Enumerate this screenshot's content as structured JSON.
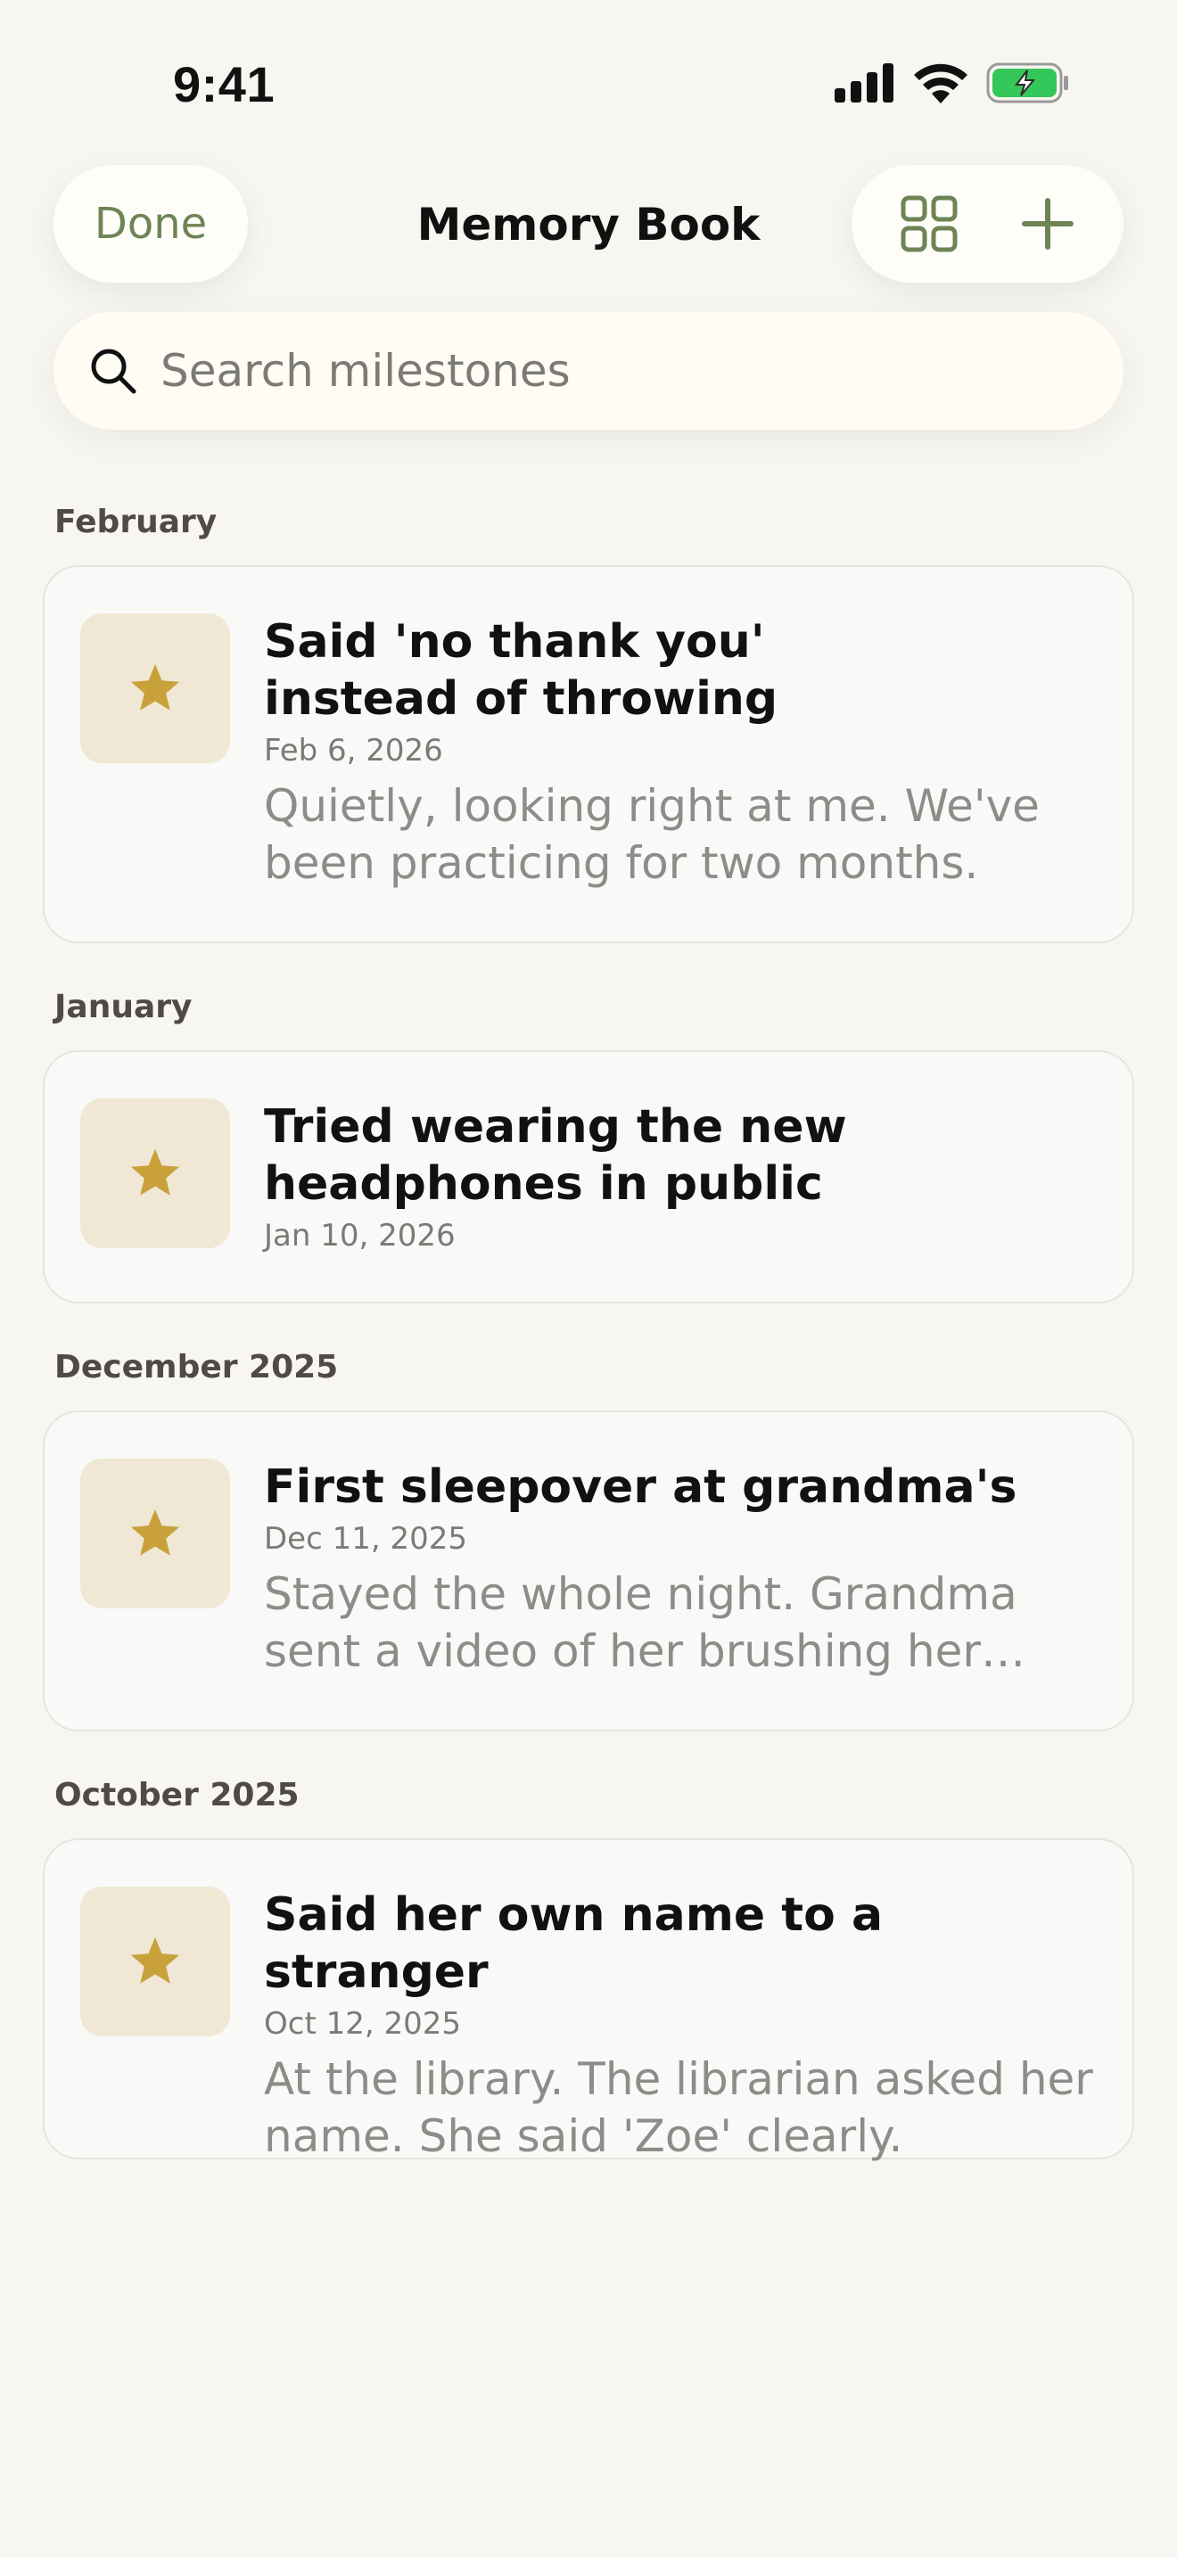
{
  "status": {
    "time": "9:41"
  },
  "nav": {
    "done_label": "Done",
    "title": "Memory Book",
    "grid_icon": "grid-icon",
    "add_icon": "plus-icon"
  },
  "search": {
    "placeholder": "Search milestones",
    "icon": "search-icon"
  },
  "sections": [
    {
      "label": "February",
      "items": [
        {
          "title": "Said 'no thank you' instead of throwing",
          "date": "Feb 6, 2026",
          "note": "Quietly, looking right at me. We've been practicing for two months."
        }
      ]
    },
    {
      "label": "January",
      "items": [
        {
          "title": "Tried wearing the new headphones in public",
          "date": "Jan 10, 2026",
          "note": ""
        }
      ]
    },
    {
      "label": "December 2025",
      "items": [
        {
          "title": "First sleepover at grandma's",
          "date": "Dec 11, 2025",
          "note": "Stayed the whole night. Grandma sent a video of her brushing her own…"
        }
      ]
    },
    {
      "label": "October 2025",
      "items": [
        {
          "title": "Said her own name to a stranger",
          "date": "Oct 12, 2025",
          "note": "At the library. The librarian asked her name. She said 'Zoe' clearly."
        }
      ]
    }
  ],
  "colors": {
    "accent": "#6f8455",
    "star": "#c9a13b",
    "thumb_bg": "#f0e8d5",
    "battery": "#34c759"
  }
}
